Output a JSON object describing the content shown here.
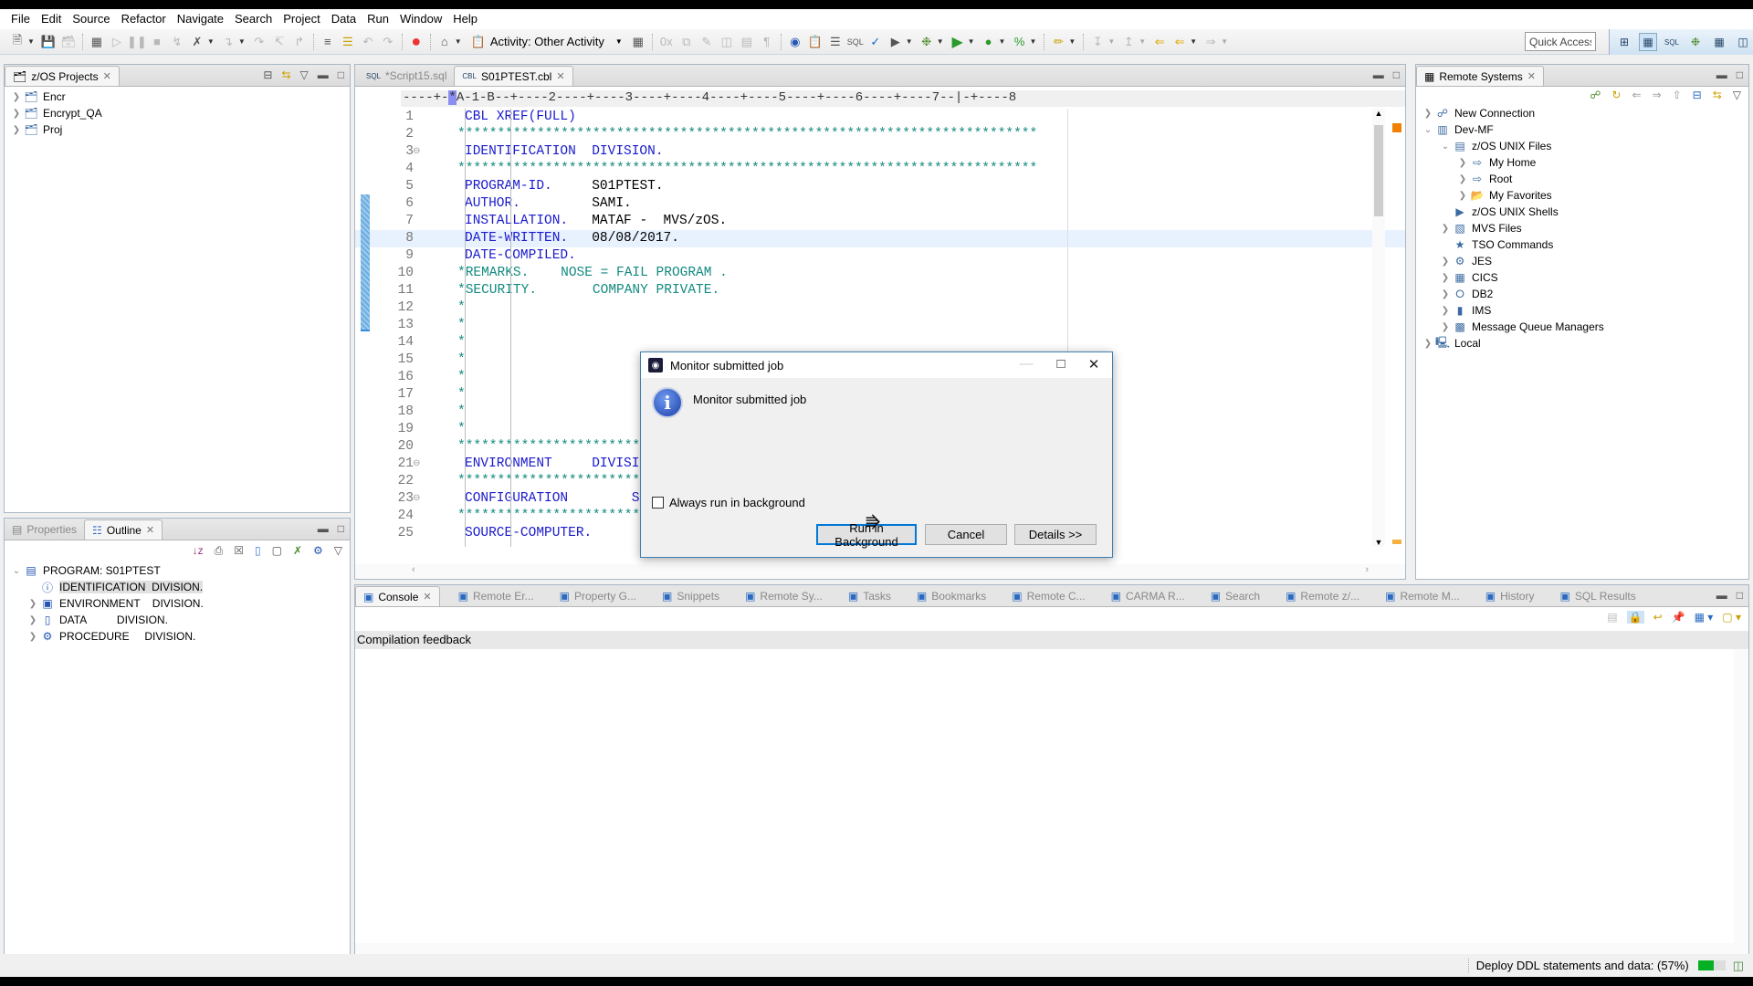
{
  "menubar": [
    "File",
    "Edit",
    "Source",
    "Refactor",
    "Navigate",
    "Search",
    "Project",
    "Data",
    "Run",
    "Window",
    "Help"
  ],
  "toolbar": {
    "activity_label": "Activity: Other Activity",
    "quick_access": "Quick Access"
  },
  "left_top_view": {
    "tab_label": "z/OS Projects",
    "projects": [
      "Encr",
      "Encrypt_QA",
      "Proj"
    ]
  },
  "left_bottom_view": {
    "tabs": [
      "Properties",
      "Outline"
    ],
    "active_tab": "Outline",
    "outline": [
      {
        "label": "PROGRAM: S01PTEST",
        "level": 0,
        "expanded": true,
        "icon": "cbl-program-icon"
      },
      {
        "label": "IDENTIFICATION  DIVISION.",
        "level": 1,
        "expandable": false,
        "selected": true,
        "icon": "id-icon"
      },
      {
        "label": "ENVIRONMENT    DIVISION.",
        "level": 1,
        "expandable": true,
        "icon": "environment-icon"
      },
      {
        "label": "DATA          DIVISION.",
        "level": 1,
        "expandable": true,
        "icon": "data-cylinder-icon"
      },
      {
        "label": "PROCEDURE     DIVISION.",
        "level": 1,
        "expandable": true,
        "icon": "gears-icon"
      }
    ]
  },
  "editor": {
    "tabs": [
      {
        "label": "*Script15.sql",
        "active": false
      },
      {
        "label": "S01PTEST.cbl",
        "active": true
      }
    ],
    "ruler": "----+-*A-1-B--+----2----+----3----+----4----+----5----+----6----+----7--|-+----8",
    "highlighted_line": 8,
    "lines": [
      {
        "n": "1",
        "text": "CBL XREF(FULL)",
        "type": "kw",
        "indent": 1
      },
      {
        "n": "2",
        "text": "*************************************************************************",
        "type": "cm",
        "indent": 0
      },
      {
        "n": "3",
        "text": "IDENTIFICATION  DIVISION.",
        "type": "kw",
        "indent": 1,
        "fold": true
      },
      {
        "n": "4",
        "text": "*************************************************************************",
        "type": "cm",
        "indent": 0
      },
      {
        "n": "5",
        "text": "PROGRAM-ID.     S01PTEST.",
        "type": "kwval",
        "indent": 1
      },
      {
        "n": "6",
        "text": "AUTHOR.         SAMI.",
        "type": "kwval",
        "indent": 1
      },
      {
        "n": "7",
        "text": "INSTALLATION.   MATAF -  MVS/zOS.",
        "type": "kwval",
        "indent": 1
      },
      {
        "n": "8",
        "text": "DATE-WRITTEN.   08/08/2017.",
        "type": "kwval",
        "indent": 1
      },
      {
        "n": "9",
        "text": "DATE-COMPILED.",
        "type": "kw",
        "indent": 1
      },
      {
        "n": "10",
        "text": "*REMARKS.    NOSE = FAIL PROGRAM .",
        "type": "cm",
        "indent": 0
      },
      {
        "n": "11",
        "text": "*SECURITY.       COMPANY PRIVATE.",
        "type": "cm",
        "indent": 0
      },
      {
        "n": "12",
        "text": "*",
        "type": "cm",
        "indent": 0
      },
      {
        "n": "13",
        "text": "*",
        "type": "cm",
        "indent": 0
      },
      {
        "n": "14",
        "text": "*",
        "type": "cm",
        "indent": 0
      },
      {
        "n": "15",
        "text": "*",
        "type": "cm",
        "indent": 0
      },
      {
        "n": "16",
        "text": "*",
        "type": "cm",
        "indent": 0
      },
      {
        "n": "17",
        "text": "*",
        "type": "cm",
        "indent": 0
      },
      {
        "n": "18",
        "text": "*",
        "type": "cm",
        "indent": 0
      },
      {
        "n": "19",
        "text": "*",
        "type": "cm",
        "indent": 0
      },
      {
        "n": "20",
        "text": "*************************************************************************",
        "type": "cm",
        "indent": 0
      },
      {
        "n": "21",
        "text": "ENVIRONMENT     DIVISION.",
        "type": "kw",
        "indent": 1,
        "fold": true
      },
      {
        "n": "22",
        "text": "*************************************************************************",
        "type": "cm",
        "indent": 0
      },
      {
        "n": "23",
        "text": "CONFIGURATION        SECTION.",
        "type": "kw",
        "indent": 1,
        "fold": true
      },
      {
        "n": "24",
        "text": "*************************************************************************",
        "type": "cm",
        "indent": 0
      },
      {
        "n": "25",
        "text": "SOURCE-COMPUTER.",
        "type": "kw",
        "indent": 1
      }
    ]
  },
  "remote_systems": {
    "tab_label": "Remote Systems",
    "tree": [
      {
        "label": "New Connection",
        "level": 0,
        "twisty": "closed",
        "icon": "new-connection-icon"
      },
      {
        "label": "Dev-MF",
        "level": 0,
        "twisty": "open",
        "icon": "mainframe-icon"
      },
      {
        "label": "z/OS UNIX Files",
        "level": 1,
        "twisty": "open",
        "icon": "unix-files-icon"
      },
      {
        "label": "My Home",
        "level": 2,
        "twisty": "closed",
        "icon": "filter-icon"
      },
      {
        "label": "Root",
        "level": 2,
        "twisty": "closed",
        "icon": "filter-icon"
      },
      {
        "label": "My Favorites",
        "level": 2,
        "twisty": "closed",
        "icon": "favorites-folder-icon"
      },
      {
        "label": "z/OS UNIX Shells",
        "level": 1,
        "twisty": "none",
        "icon": "shell-icon"
      },
      {
        "label": "MVS Files",
        "level": 1,
        "twisty": "closed",
        "icon": "mvs-files-icon"
      },
      {
        "label": "TSO Commands",
        "level": 1,
        "twisty": "none",
        "icon": "tso-icon"
      },
      {
        "label": "JES",
        "level": 1,
        "twisty": "closed",
        "icon": "jes-icon"
      },
      {
        "label": "CICS",
        "level": 1,
        "twisty": "closed",
        "icon": "cics-icon"
      },
      {
        "label": "DB2",
        "level": 1,
        "twisty": "closed",
        "icon": "db2-icon"
      },
      {
        "label": "IMS",
        "level": 1,
        "twisty": "closed",
        "icon": "ims-icon"
      },
      {
        "label": "Message Queue Managers",
        "level": 1,
        "twisty": "closed",
        "icon": "mq-icon"
      },
      {
        "label": "Local",
        "level": 0,
        "twisty": "closed",
        "icon": "local-icon"
      }
    ]
  },
  "bottom_view": {
    "tabs": [
      "Console",
      "Remote Er...",
      "Property G...",
      "Snippets",
      "Remote Sy...",
      "Tasks",
      "Bookmarks",
      "Remote C...",
      "CARMA R...",
      "Search",
      "Remote z/...",
      "Remote M...",
      "History",
      "SQL Results"
    ],
    "active_tab": "Console",
    "console_title": "Compilation feedback"
  },
  "dialog": {
    "title": "Monitor submitted job",
    "message": "Monitor submitted job",
    "checkbox_label": "Always run in background",
    "checkbox_checked": false,
    "buttons": {
      "run_bg": "Run in Background",
      "cancel": "Cancel",
      "details": "Details >>"
    }
  },
  "status": {
    "task": "Deploy DDL statements and data: (57%)",
    "progress_percent": 57
  }
}
